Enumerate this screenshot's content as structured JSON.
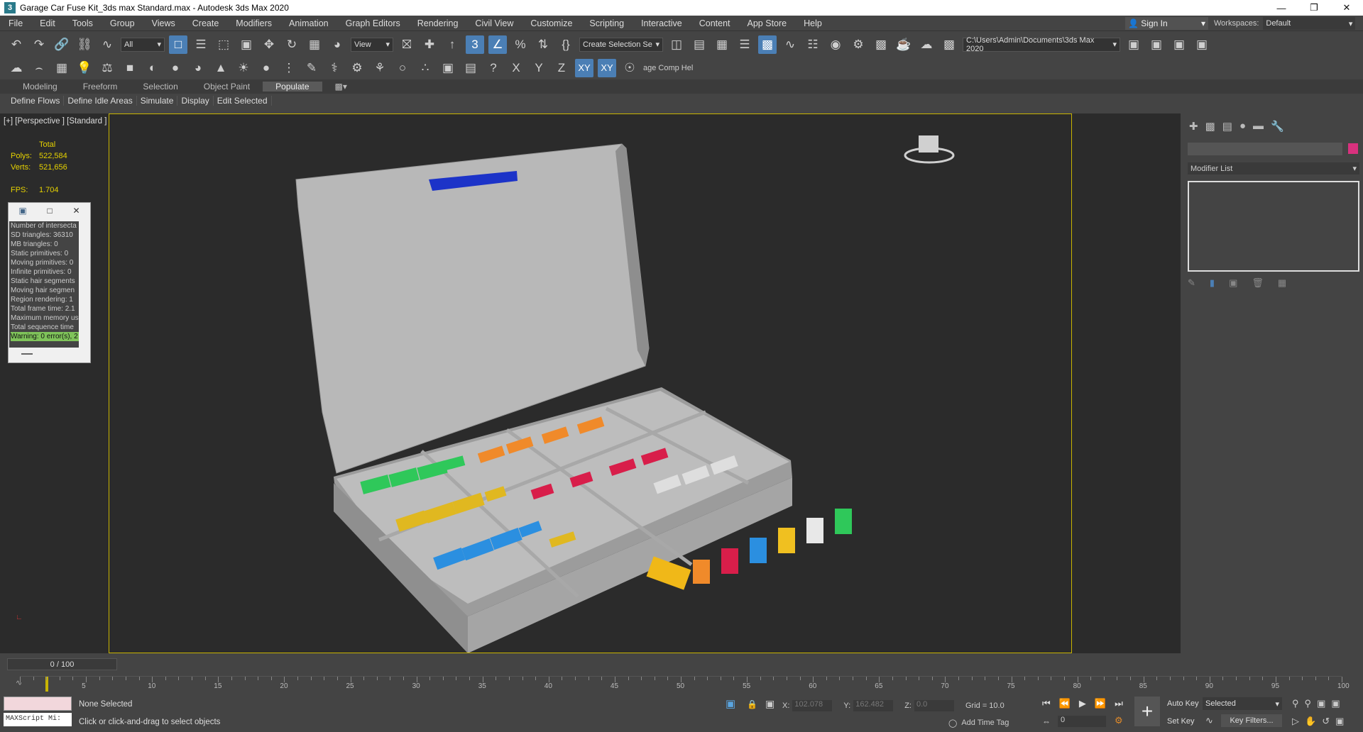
{
  "window": {
    "title": "Garage Car Fuse Kit_3ds max Standard.max - Autodesk 3ds Max 2020",
    "buttons": [
      "minimize-icon",
      "restore-icon",
      "close-icon"
    ]
  },
  "menu": [
    "File",
    "Edit",
    "Tools",
    "Group",
    "Views",
    "Create",
    "Modifiers",
    "Animation",
    "Graph Editors",
    "Rendering",
    "Civil View",
    "Customize",
    "Scripting",
    "Interactive",
    "Content",
    "App Store",
    "Help"
  ],
  "account": {
    "signin": "Sign In",
    "workspaces_label": "Workspaces:",
    "workspace": "Default"
  },
  "toolbar": {
    "filter": "All",
    "ref_coord": "View",
    "selection_set": "Create Selection Se",
    "project_path": "C:\\Users\\Admin\\Documents\\3ds Max 2020",
    "axes": [
      "X",
      "Y",
      "Z",
      "XY",
      "XY"
    ],
    "comp_help": "age Comp Hel"
  },
  "ribbon": {
    "tabs": [
      "Modeling",
      "Freeform",
      "Selection",
      "Object Paint",
      "Populate"
    ],
    "active": "Populate",
    "buttons": [
      "Define Flows",
      "Define Idle Areas",
      "Simulate",
      "Display",
      "Edit Selected"
    ]
  },
  "viewport": {
    "label": "[+] [Perspective ] [Standard ] [Default Shading ]",
    "stats": {
      "total": "Total",
      "polys_label": "Polys:",
      "polys": "522,584",
      "verts_label": "Verts:",
      "verts": "521,656",
      "fps_label": "FPS:",
      "fps": "1.704"
    },
    "log": [
      "Number of intersecta",
      "SD triangles: 36310",
      "MB triangles: 0",
      "Static primitives: 0",
      "Moving primitives: 0",
      "Infinite primitives: 0",
      "Static hair segments",
      "Moving hair segmen",
      "Region rendering: 1",
      "Total frame time: 2.1",
      "Maximum memory us",
      "Total sequence time",
      "Warning: 0 error(s), 2"
    ]
  },
  "command_panel": {
    "modifier_list": "Modifier List"
  },
  "timeline": {
    "frame": "0 / 100",
    "ticks": [
      "5",
      "10",
      "15",
      "20",
      "25",
      "30",
      "35",
      "40",
      "45",
      "50",
      "55",
      "60",
      "65",
      "70",
      "75",
      "80",
      "85",
      "90",
      "95",
      "100"
    ]
  },
  "status": {
    "maxscript": "MAXScript Mi:",
    "selection": "None Selected",
    "prompt": "Click or click-and-drag to select objects",
    "x_label": "X:",
    "x": "102.078",
    "y_label": "Y:",
    "y": "162.482",
    "z_label": "Z:",
    "z": "0.0",
    "grid": "Grid = 10.0",
    "add_time_tag": "Add Time Tag",
    "auto_key": "Auto Key",
    "set_key": "Set Key",
    "key_mode": "Selected",
    "key_filters": "Key Filters...",
    "frame_field": "0"
  }
}
